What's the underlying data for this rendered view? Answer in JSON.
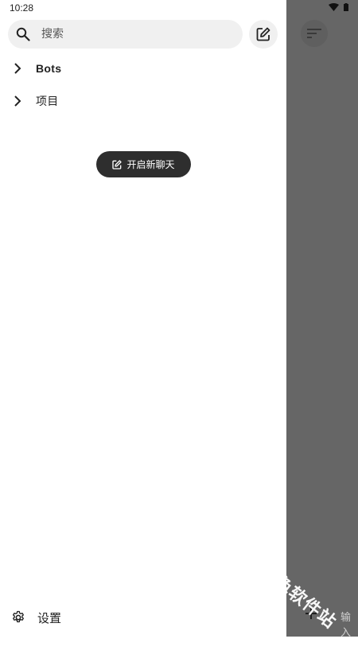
{
  "status_bar": {
    "time": "10:28",
    "wifi_icon": "wifi-icon",
    "battery_icon": "battery-icon"
  },
  "drawer": {
    "search": {
      "placeholder": "搜索",
      "value": "",
      "icon": "search-icon"
    },
    "new_chat_icon": "edit-icon",
    "nav_items": [
      {
        "label": "Bots",
        "icon": "chevron-right-icon"
      },
      {
        "label": "项目",
        "icon": "chevron-right-icon"
      }
    ],
    "new_chat_button": {
      "label": "开启新聊天",
      "icon": "edit-icon"
    },
    "settings": {
      "label": "设置",
      "icon": "gear-icon"
    }
  },
  "main": {
    "sort_icon": "sort-icon",
    "add_icon": "plus-icon",
    "input_hint": "输入"
  },
  "watermark": "绿色软件站",
  "colors": {
    "scrim": "#666666",
    "button_dark": "#2e2e2e",
    "search_bg": "#f0f0f0"
  }
}
